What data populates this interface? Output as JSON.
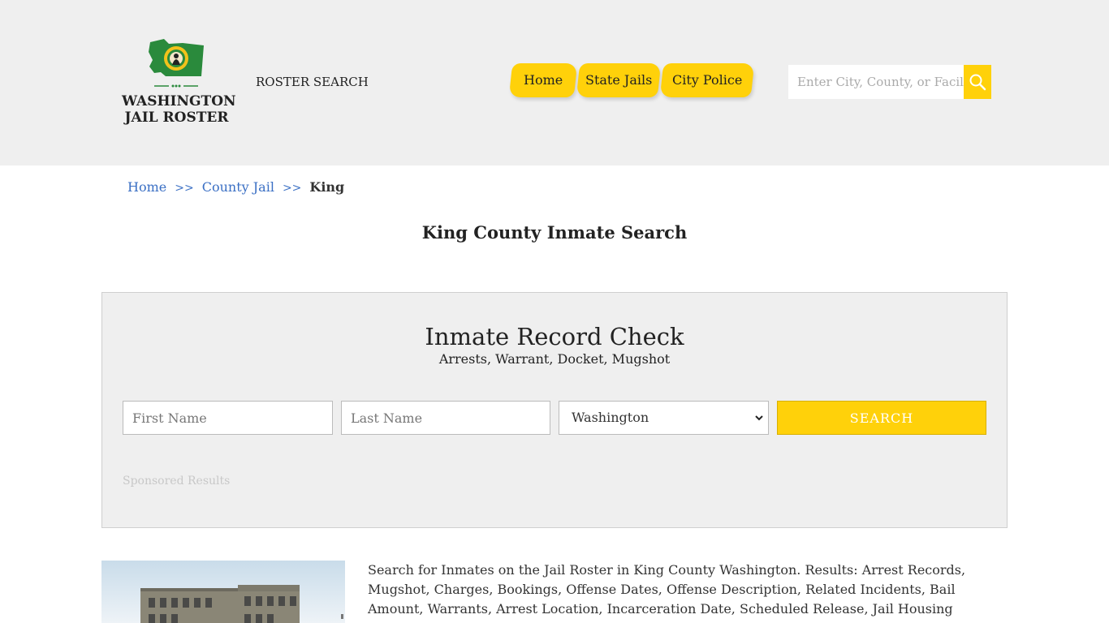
{
  "header": {
    "logo_line1": "WASHINGTON",
    "logo_line2": "JAIL ROSTER",
    "roster_search": "ROSTER SEARCH",
    "nav": [
      {
        "label": "Home"
      },
      {
        "label": "State Jails"
      },
      {
        "label": "City Police"
      }
    ],
    "search_placeholder": "Enter City, County, or Facility",
    "accent_color": "#ffd10a"
  },
  "breadcrumb": {
    "home": "Home",
    "sep": ">>",
    "county_jail": "County Jail",
    "current": "King"
  },
  "page_title": "King County Inmate Search",
  "record_check": {
    "title": "Inmate Record Check",
    "subtitle": "Arrests, Warrant, Docket, Mugshot",
    "first_name_placeholder": "First Name",
    "last_name_placeholder": "Last Name",
    "state_selected": "Washington",
    "search_button": "SEARCH",
    "sponsored": "Sponsored Results"
  },
  "description": "Search for Inmates on the Jail Roster in King County Washington. Results: Arrest Records, Mugshot, Charges, Bookings, Offense Dates, Offense Description, Related Incidents, Bail Amount, Warrants, Arrest Location, Incarceration Date, Scheduled Release, Jail Housing Location, Court."
}
